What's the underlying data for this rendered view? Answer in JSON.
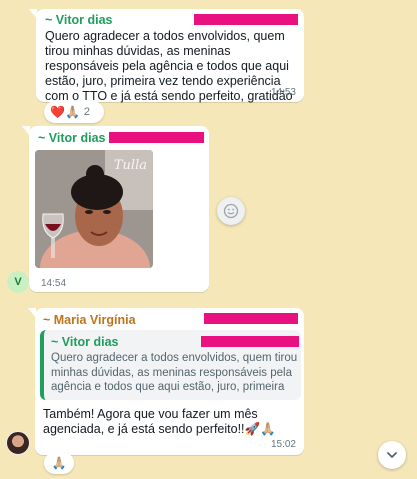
{
  "messages": {
    "m1": {
      "sender": "~ Vitor dias",
      "text": "Quero agradecer a todos envolvidos, quem tirou minhas dúvidas, as meninas responsáveis pela agência e todos que aqui estão, juro, primeira vez tendo experiência com o TTO e já está sendo perfeito, gratidão ❤️",
      "time": "14:53",
      "reaction_emojis": "❤️🙏🏼",
      "reaction_count": "2"
    },
    "m2": {
      "sender": "~ Vitor dias",
      "sticker_text": "Tulla",
      "time": "14:54",
      "avatar_initial": "V"
    },
    "m3": {
      "sender": "~ Maria Virgínia",
      "quote_sender": "~ Vitor dias",
      "quote_text": "Quero agradecer a todos envolvidos, quem tirou minhas dúvidas, as meninas responsáveis pela agência e todos que aqui estão, juro, primeira vez...",
      "text": "Também! Agora que vou fazer um mês agenciada, e já está sendo perfeito!!🚀🙏🏼",
      "time": "15:02",
      "reaction_emojis": "🙏🏼"
    }
  },
  "colors": {
    "background": "#f6e7b8",
    "sender_green": "#1f9e5e",
    "sender_orange": "#c0731a",
    "redaction": "#e8117f"
  },
  "icons": [
    "emoji-reaction-icon",
    "scroll-down-chevron-icon"
  ]
}
